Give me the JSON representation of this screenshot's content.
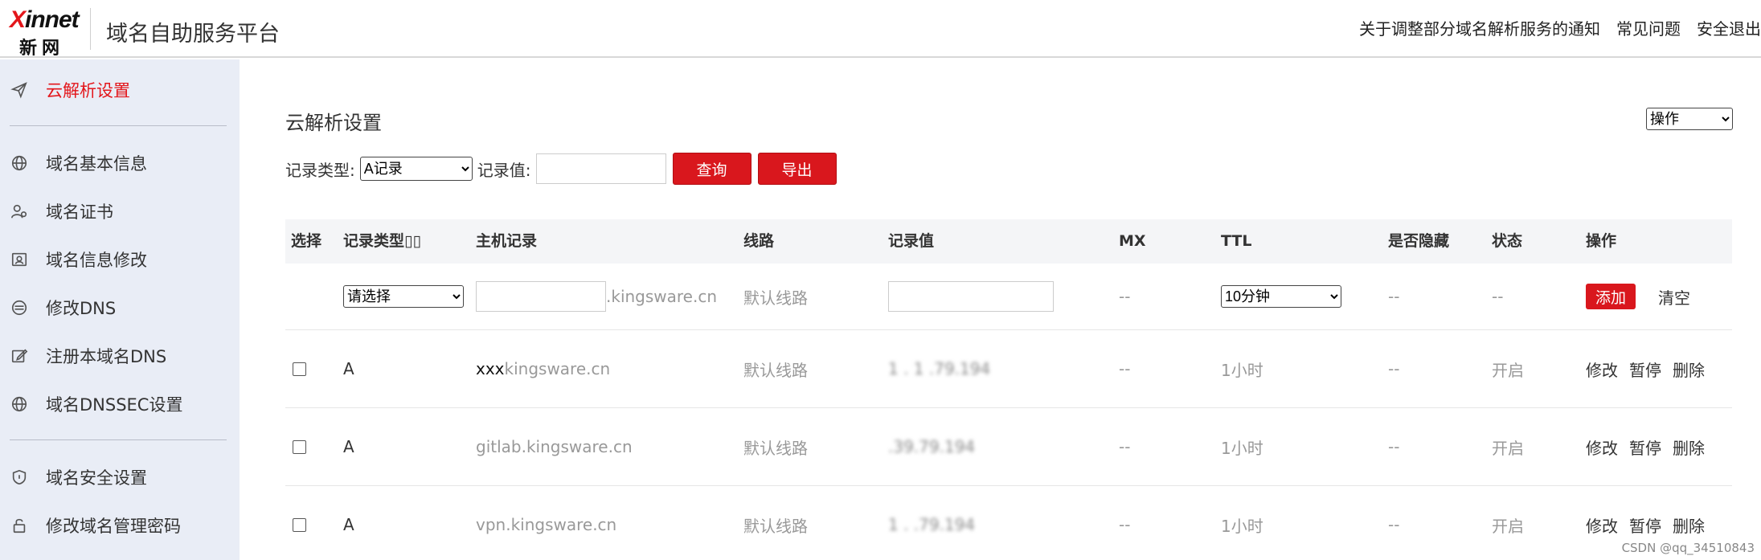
{
  "header": {
    "logo_brand_x": "X",
    "logo_brand_rest": "innet",
    "logo_cn": "新网",
    "platform_title": "域名自助服务平台",
    "links": [
      "关于调整部分域名解析服务的通知",
      "常见问题",
      "安全退出"
    ]
  },
  "sidebar": {
    "items": [
      {
        "label": "云解析设置",
        "icon": "paper-plane-icon",
        "active": true
      },
      {
        "label": "域名基本信息",
        "icon": "globe-icon"
      },
      {
        "label": "域名证书",
        "icon": "user-certificate-icon"
      },
      {
        "label": "域名信息修改",
        "icon": "id-card-icon"
      },
      {
        "label": "修改DNS",
        "icon": "dns-server-icon"
      },
      {
        "label": "注册本域名DNS",
        "icon": "edit-icon"
      },
      {
        "label": "域名DNSSEC设置",
        "icon": "globe-icon"
      },
      {
        "label": "域名安全设置",
        "icon": "shield-icon"
      },
      {
        "label": "修改域名管理密码",
        "icon": "lock-icon"
      }
    ]
  },
  "main": {
    "title": "云解析设置",
    "operation_select": "操作",
    "filter": {
      "type_label": "记录类型:",
      "type_value": "A记录",
      "value_label": "记录值:",
      "value_input": "",
      "query_button": "查询",
      "export_button": "导出"
    },
    "table": {
      "headers": [
        "选择",
        "记录类型▯▯",
        "主机记录",
        "线路",
        "记录值",
        "MX",
        "TTL",
        "是否隐藏",
        "状态",
        "操作"
      ],
      "add_row": {
        "type_select": "请选择",
        "host_input": "",
        "host_suffix": ".kingsware.cn",
        "line": "默认线路",
        "value_input": "",
        "mx": "--",
        "ttl_select": "10分钟",
        "hidden": "--",
        "status": "--",
        "add_button": "添加",
        "clear_button": "清空"
      },
      "rows": [
        {
          "type": "A",
          "host_prefix": "xxx",
          "host": "kingsware.cn",
          "line": "默认线路",
          "value": "1 . 1 .79.194",
          "mx": "--",
          "ttl": "1小时",
          "hidden": "--",
          "status": "开启",
          "actions": [
            "修改",
            "暂停",
            "删除"
          ]
        },
        {
          "type": "A",
          "host_prefix": "",
          "host": "gitlab.kingsware.cn",
          "line": "默认线路",
          "value": "  .39.79.194",
          "mx": "--",
          "ttl": "1小时",
          "hidden": "--",
          "status": "开启",
          "actions": [
            "修改",
            "暂停",
            "删除"
          ]
        },
        {
          "type": "A",
          "host_prefix": "",
          "host": "vpn.kingsware.cn",
          "line": "默认线路",
          "value": "1 . .79.194",
          "mx": "--",
          "ttl": "1小时",
          "hidden": "--",
          "status": "开启",
          "actions": [
            "修改",
            "暂停",
            "删除"
          ]
        }
      ]
    }
  },
  "watermark": "CSDN @qq_34510843",
  "colors": {
    "accent": "#d9171d",
    "sidebar_bg": "#e9edf6",
    "header_bg": "#f4f5f7"
  }
}
